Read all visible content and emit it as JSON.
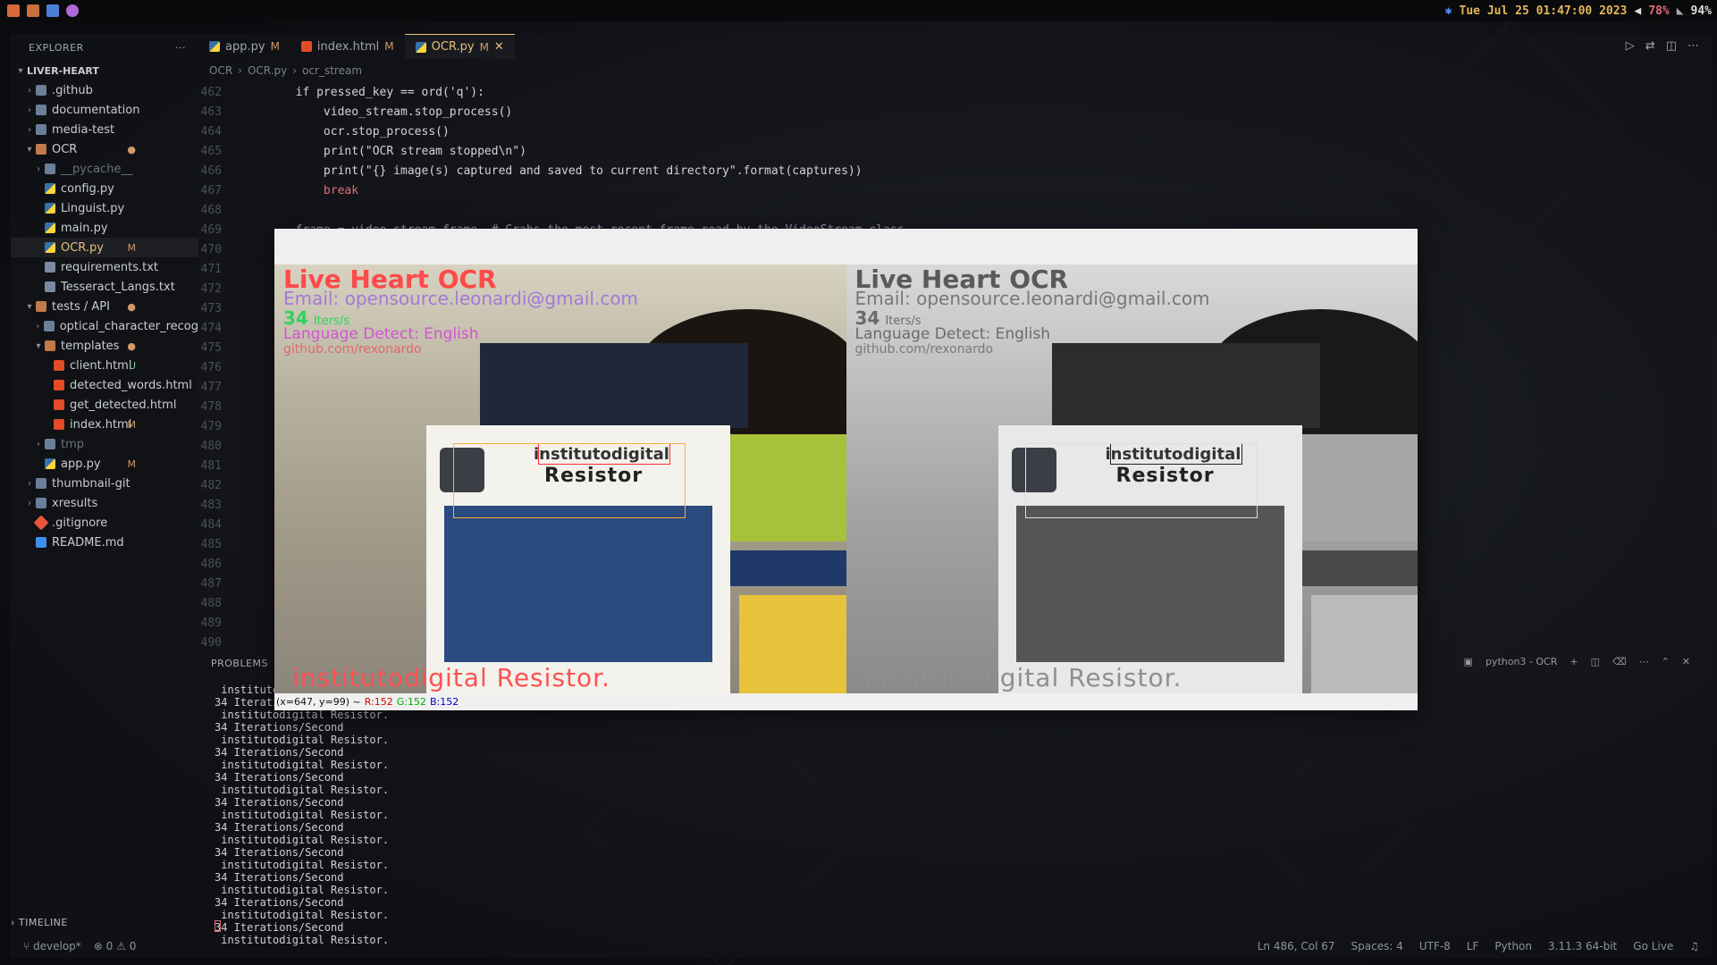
{
  "topbar": {
    "datetime": "Tue Jul 25 01:47:00 2023",
    "battery": "78%",
    "volume": "94%"
  },
  "explorer": {
    "title": "EXPLORER",
    "more": "···",
    "root": "LIVER-HEART",
    "items": [
      {
        "label": ".github",
        "depth": 1,
        "type": "folder",
        "open": false,
        "badge": ""
      },
      {
        "label": "documentation",
        "depth": 1,
        "type": "folder",
        "open": false,
        "badge": ""
      },
      {
        "label": "media-test",
        "depth": 1,
        "type": "folder",
        "open": false,
        "badge": ""
      },
      {
        "label": "OCR",
        "depth": 1,
        "type": "folder",
        "open": true,
        "badge": "●"
      },
      {
        "label": "__pycache__",
        "depth": 2,
        "type": "folder",
        "open": false,
        "badge": ""
      },
      {
        "label": "config.py",
        "depth": 2,
        "type": "py",
        "badge": ""
      },
      {
        "label": "Linguist.py",
        "depth": 2,
        "type": "py",
        "badge": ""
      },
      {
        "label": "main.py",
        "depth": 2,
        "type": "py",
        "badge": ""
      },
      {
        "label": "OCR.py",
        "depth": 2,
        "type": "py",
        "badge": "M",
        "selected": true
      },
      {
        "label": "requirements.txt",
        "depth": 2,
        "type": "txt",
        "badge": ""
      },
      {
        "label": "Tesseract_Langs.txt",
        "depth": 2,
        "type": "txt",
        "badge": ""
      },
      {
        "label": "tests / API",
        "depth": 1,
        "type": "folder",
        "open": true,
        "badge": "●"
      },
      {
        "label": "optical_character_recog",
        "depth": 2,
        "type": "folder",
        "open": false,
        "badge": ""
      },
      {
        "label": "templates",
        "depth": 2,
        "type": "folder",
        "open": true,
        "badge": "●"
      },
      {
        "label": "client.html",
        "depth": 3,
        "type": "html",
        "badge": "U"
      },
      {
        "label": "detected_words.html",
        "depth": 3,
        "type": "html",
        "badge": ""
      },
      {
        "label": "get_detected.html",
        "depth": 3,
        "type": "html",
        "badge": ""
      },
      {
        "label": "index.html",
        "depth": 3,
        "type": "html",
        "badge": "M"
      },
      {
        "label": "tmp",
        "depth": 2,
        "type": "folder",
        "open": false,
        "badge": ""
      },
      {
        "label": "app.py",
        "depth": 2,
        "type": "py",
        "badge": "M"
      },
      {
        "label": "thumbnail-git",
        "depth": 1,
        "type": "folder",
        "open": false,
        "badge": ""
      },
      {
        "label": "xresults",
        "depth": 1,
        "type": "folder",
        "open": false,
        "badge": ""
      },
      {
        "label": ".gitignore",
        "depth": 1,
        "type": "git",
        "badge": ""
      },
      {
        "label": "README.md",
        "depth": 1,
        "type": "info",
        "badge": ""
      }
    ],
    "timeline": "TIMELINE"
  },
  "tabs": [
    {
      "label": "app.py",
      "badge": "M",
      "active": false,
      "icon": "python-icon"
    },
    {
      "label": "index.html",
      "badge": "M",
      "active": false,
      "icon": "html-icon"
    },
    {
      "label": "OCR.py",
      "badge": "M",
      "active": true,
      "icon": "python-icon",
      "close": "✕"
    }
  ],
  "breadcrumb": [
    "OCR",
    "OCR.py",
    "ocr_stream"
  ],
  "code": {
    "lines": [
      {
        "n": "462",
        "text": "        if pressed_key == ord('q'):"
      },
      {
        "n": "463",
        "text": "            video_stream.stop_process()"
      },
      {
        "n": "464",
        "text": "            ocr.stop_process()"
      },
      {
        "n": "465",
        "text": "            print(\"OCR stream stopped\\n\")"
      },
      {
        "n": "466",
        "text": "            print(\"{} image(s) captured and saved to current directory\".format(captures))"
      },
      {
        "n": "467",
        "text": "            break"
      },
      {
        "n": "468",
        "text": ""
      },
      {
        "n": "469",
        "text": "        frame = video_stream.frame  # Grabs the most recent frame read by the VideoStream class"
      },
      {
        "n": "470",
        "text": ""
      },
      {
        "n": "471",
        "text": ""
      },
      {
        "n": "472",
        "text": ""
      },
      {
        "n": "473",
        "text": ""
      },
      {
        "n": "474",
        "text": ""
      },
      {
        "n": "475",
        "text": ""
      },
      {
        "n": "476",
        "text": ""
      },
      {
        "n": "477",
        "text": ""
      },
      {
        "n": "478",
        "text": ""
      },
      {
        "n": "479",
        "text": ""
      },
      {
        "n": "480",
        "text": ""
      },
      {
        "n": "481",
        "text": ""
      },
      {
        "n": "482",
        "text": ""
      },
      {
        "n": "483",
        "text": ""
      },
      {
        "n": "484",
        "text": ""
      },
      {
        "n": "485",
        "text": ""
      },
      {
        "n": "486",
        "text": ""
      },
      {
        "n": "487",
        "text": ""
      },
      {
        "n": "488",
        "text": ""
      },
      {
        "n": "489",
        "text": ""
      },
      {
        "n": "490",
        "text": ""
      }
    ]
  },
  "panel": {
    "tab": "PROBLEMS",
    "terminal_name": "python3 - OCR",
    "terminal_lines": [
      " institutodigital Resistor.",
      "34 Iterations/Second",
      " institutodigital Resistor.",
      "34 Iterations/Second",
      " institutodigital Resistor.",
      "34 Iterations/Second",
      " institutodigital Resistor.",
      "34 Iterations/Second",
      " institutodigital Resistor.",
      "34 Iterations/Second",
      " institutodigital Resistor.",
      "34 Iterations/Second",
      " institutodigital Resistor.",
      "34 Iterations/Second",
      " institutodigital Resistor.",
      "34 Iterations/Second",
      " institutodigital Resistor.",
      "34 Iterations/Second",
      " institutodigital Resistor.",
      "34 Iterations/Second",
      " institutodigital Resistor."
    ]
  },
  "status": {
    "branch": "develop*",
    "errors": "0",
    "warnings": "0",
    "position": "Ln 486, Col 67",
    "spaces": "Spaces: 4",
    "encoding": "UTF-8",
    "eol": "LF",
    "language": "Python",
    "interpreter": "3.11.3 64-bit",
    "live": "Go Live"
  },
  "ocr_window": {
    "overlay_title": "Live Heart OCR",
    "overlay_email": "Email: opensource.leonardi@gmail.com",
    "overlay_fps": "34",
    "overlay_fps_unit": "Iters/s",
    "overlay_language": "Language Detect: English",
    "overlay_github": "github.com/rexonardo",
    "board_text_1": "institutodigital",
    "board_text_2": "Resistor",
    "detected_text": "institutodigital Resistor.",
    "pixel_coords": "(x=647, y=99) ~",
    "pixel_r": "R:152",
    "pixel_g": "G:152",
    "pixel_b": "B:152"
  }
}
